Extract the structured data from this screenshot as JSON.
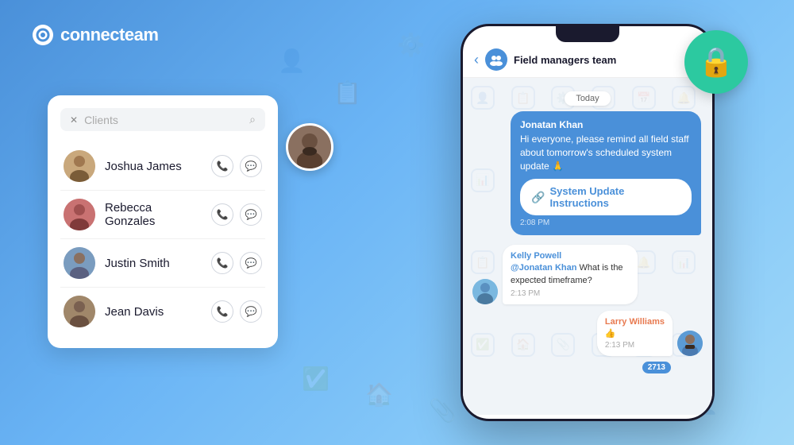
{
  "app": {
    "logo_text": "connecteam"
  },
  "background_icons": [
    "👤",
    "📋",
    "📞",
    "💬",
    "⚙️",
    "📅",
    "🔔",
    "📊",
    "✅",
    "🏠",
    "📎",
    "🔗"
  ],
  "contact_list": {
    "search_placeholder": "Clients",
    "contacts": [
      {
        "id": "joshua",
        "name": "Joshua James"
      },
      {
        "id": "rebecca",
        "name": "Rebecca Gonzales"
      },
      {
        "id": "justin",
        "name": "Justin Smith"
      },
      {
        "id": "jean",
        "name": "Jean Davis"
      }
    ]
  },
  "phone": {
    "header_title": "Field managers team",
    "today_label": "Today",
    "messages": [
      {
        "type": "outgoing",
        "sender": "Jonatan Khan",
        "text": "Hi everyone, please remind all field staff about tomorrow's scheduled system update 🙏",
        "time": "2:08 PM",
        "link_label": "System Update Instructions"
      },
      {
        "type": "incoming",
        "sender": "Kelly Powell",
        "mention": "@Jonatan Khan",
        "text": " What is the expected timeframe?",
        "time": "2:13 PM",
        "avatar_color": "#7ab8e0"
      },
      {
        "type": "incoming_right",
        "sender": "Larry Williams",
        "text": "👍",
        "time": "2:13 PM",
        "badge": "2713",
        "avatar_color": "#5b9bd5"
      }
    ]
  }
}
